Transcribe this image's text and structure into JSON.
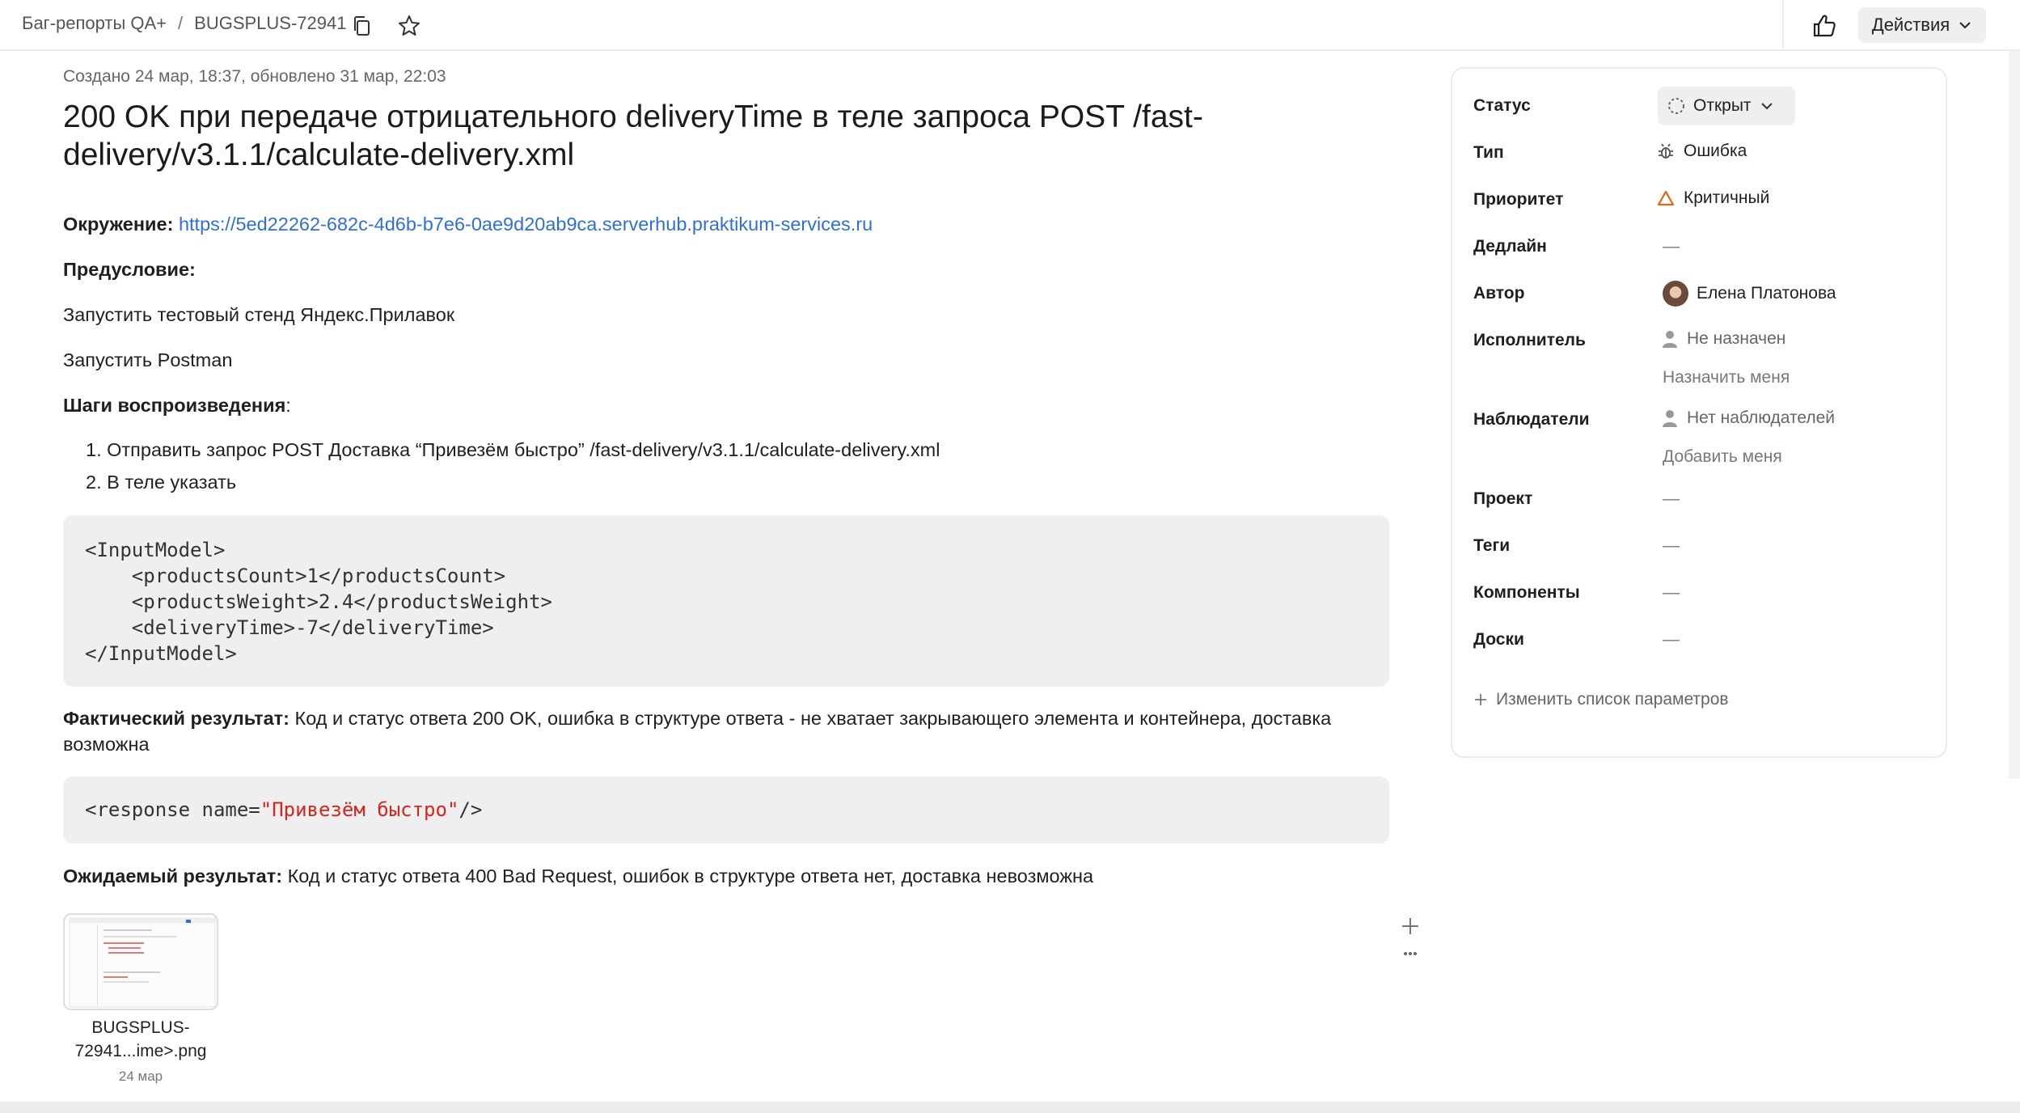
{
  "topbar": {
    "queue": "Баг-репорты QA+",
    "separator": "/",
    "issue_key": "BUGSPLUS-72941",
    "actions_label": "Действия"
  },
  "issue": {
    "meta": "Создано 24 мар, 18:37, обновлено 31 мар, 22:03",
    "title": "200 OK при передаче отрицательного deliveryTime в теле запроса POST /fast-delivery/v3.1.1/calculate-delivery.xml",
    "env_label": "Окружение:",
    "env_url": "https://5ed22262-682c-4d6b-b7e6-0ae9d20ab9ca.serverhub.praktikum-services.ru",
    "precondition_label": "Предусловие:",
    "precondition_1": "Запустить тестовый стенд Яндекс.Прилавок",
    "precondition_2": "Запустить Postman",
    "steps_label": "Шаги воспроизведения",
    "steps_colon": ":",
    "steps": [
      "1. Отправить запрос POST Доставка “Привезём быстро” /fast-delivery/v3.1.1/calculate-delivery.xml",
      "2. В теле указать"
    ],
    "code_request": "<InputModel>\n    <productsCount>1</productsCount>\n    <productsWeight>2.4</productsWeight>\n    <deliveryTime>-7</deliveryTime>\n</InputModel>",
    "actual_label": "Фактический результат:",
    "actual_text_1": " Код и статус ответа 200 OK, ошибка в структуре ответа - не хватает закрывающего элемента и контейнера, доставка",
    "actual_text_2": "возможна",
    "code_response_prefix": "<response name=",
    "code_response_string": "\"Привезём быстро\"",
    "code_response_suffix": "/>",
    "expected_label": "Ожидаемый результат:",
    "expected_text": " Код и статус ответа 400 Bad Request, ошибок в структуре ответа нет, доставка невозможна",
    "attachment": {
      "name_line_1": "BUGSPLUS-",
      "name_line_2": "72941...ime>.png",
      "date": "24 мар"
    }
  },
  "panel": {
    "status_label": "Статус",
    "status_value": "Открыт",
    "type_label": "Тип",
    "type_value": "Ошибка",
    "priority_label": "Приоритет",
    "priority_value": "Критичный",
    "deadline_label": "Дедлайн",
    "deadline_value": "—",
    "author_label": "Автор",
    "author_value": "Елена Платонова",
    "assignee_label": "Исполнитель",
    "assignee_value": "Не назначен",
    "assign_me": "Назначить меня",
    "watchers_label": "Наблюдатели",
    "watchers_value": "Нет наблюдателей",
    "add_me": "Добавить меня",
    "project_label": "Проект",
    "project_value": "—",
    "tags_label": "Теги",
    "tags_value": "—",
    "components_label": "Компоненты",
    "components_value": "—",
    "boards_label": "Доски",
    "boards_value": "—",
    "edit_params": "Изменить список параметров"
  },
  "colors": {
    "link": "#2f6fdb",
    "priority_critical": "#e8650f",
    "code_string": "#d5261c"
  }
}
